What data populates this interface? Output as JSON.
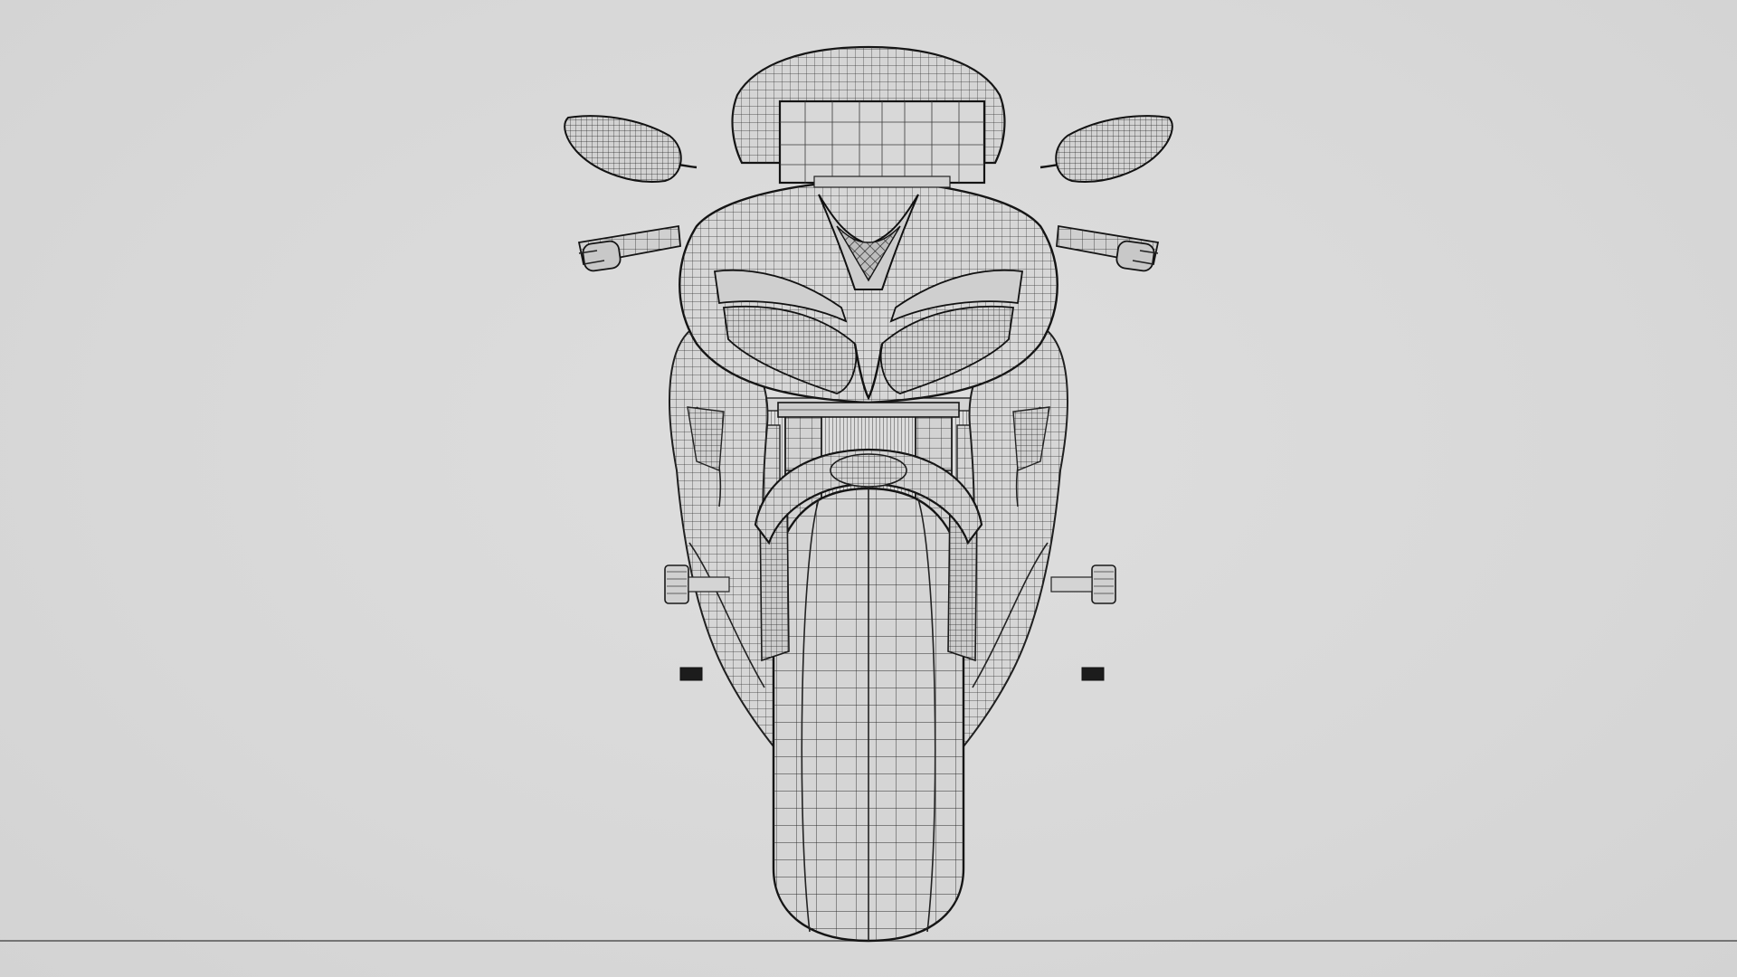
{
  "viewport": {
    "background_color": "#d9d9d9",
    "wire_color": "#2a2a2a"
  },
  "scene": {
    "subject_icon": "motorcycle-wireframe-front-view",
    "parts": [
      "windscreen",
      "instrument-display",
      "left-mirror",
      "right-mirror",
      "left-handlebar",
      "right-handlebar",
      "headlight-fairing",
      "front-fork",
      "front-fender",
      "front-wheel",
      "radiator",
      "left-footpeg",
      "right-footpeg",
      "ground-line"
    ]
  }
}
